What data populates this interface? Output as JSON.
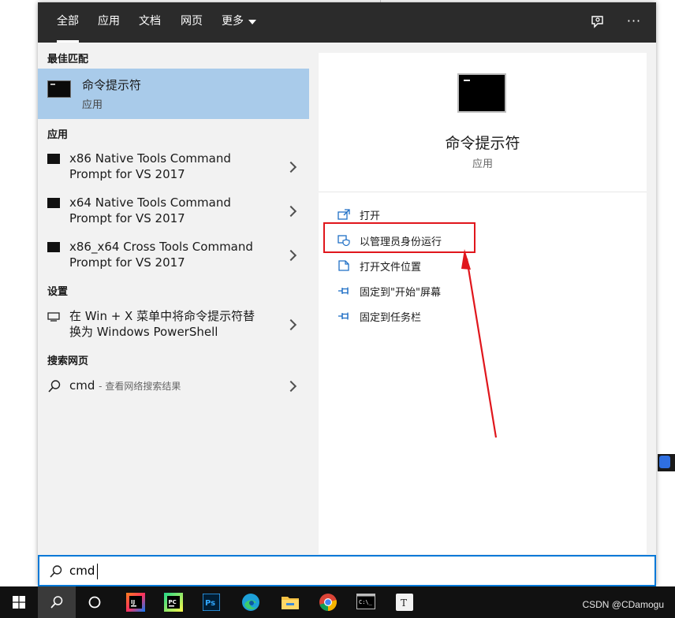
{
  "nav": {
    "tabs": [
      {
        "label": "全部",
        "active": true
      },
      {
        "label": "应用"
      },
      {
        "label": "文档"
      },
      {
        "label": "网页"
      },
      {
        "label": "更多"
      }
    ]
  },
  "results": {
    "best_match_header": "最佳匹配",
    "best_match": {
      "title": "命令提示符",
      "subtitle": "应用",
      "icon": "command-prompt-icon"
    },
    "apps_header": "应用",
    "apps": [
      {
        "line1": "x86 Native Tools Command",
        "line2": "Prompt for VS 2017",
        "icon": "command-prompt-icon"
      },
      {
        "line1": "x64 Native Tools Command",
        "line2": "Prompt for VS 2017",
        "icon": "command-prompt-icon"
      },
      {
        "line1": "x86_x64 Cross Tools Command",
        "line2": "Prompt for VS 2017",
        "icon": "command-prompt-icon"
      }
    ],
    "settings_header": "设置",
    "settings": [
      {
        "line1": "在 Win + X 菜单中将命令提示符替",
        "line2": "换为 Windows PowerShell",
        "icon": "monitor-icon"
      }
    ],
    "web_header": "搜索网页",
    "web": {
      "query": "cmd",
      "suffix": "- 查看网络搜索结果",
      "icon": "search-icon"
    }
  },
  "detail": {
    "title": "命令提示符",
    "subtitle": "应用",
    "actions": [
      {
        "label": "打开",
        "icon": "open-icon"
      },
      {
        "label": "以管理员身份运行",
        "icon": "shield-icon"
      },
      {
        "label": "打开文件位置",
        "icon": "file-location-icon"
      },
      {
        "label": "固定到\"开始\"屏幕",
        "icon": "pin-icon"
      },
      {
        "label": "固定到任务栏",
        "icon": "pin-icon"
      }
    ]
  },
  "search": {
    "value": "cmd"
  },
  "taskbar": {
    "items": [
      "windows-start-icon",
      "search-icon",
      "cortana-icon",
      "intellij-idea-icon",
      "pycharm-icon",
      "photoshop-icon",
      "edge-icon",
      "file-explorer-icon",
      "chrome-icon",
      "terminal-icon",
      "typora-icon"
    ]
  },
  "watermark": "CSDN @CDamogu",
  "colors": {
    "accent": "#0078d7",
    "selected": "#a9cbea",
    "annotation": "#e0161c",
    "nav_bg": "#2b2b2b"
  }
}
